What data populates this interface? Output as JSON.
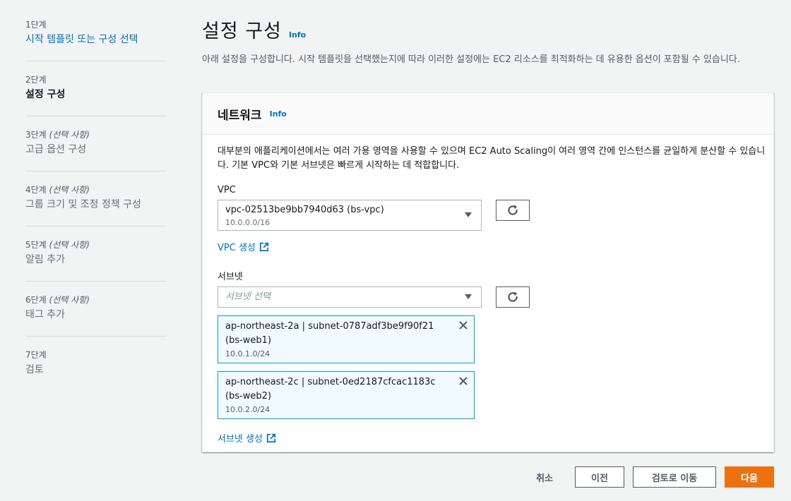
{
  "steps": [
    {
      "num": "1단계",
      "optional": "",
      "title": "시작 템플릿 또는 구성 선택",
      "state": "link"
    },
    {
      "num": "2단계",
      "optional": "",
      "title": "설정 구성",
      "state": "active"
    },
    {
      "num": "3단계",
      "optional": "(선택 사항)",
      "title": "고급 옵션 구성",
      "state": "disabled"
    },
    {
      "num": "4단계",
      "optional": "(선택 사항)",
      "title": "그룹 크기 및 조정 정책 구성",
      "state": "disabled"
    },
    {
      "num": "5단계",
      "optional": "(선택 사항)",
      "title": "알림 추가",
      "state": "disabled"
    },
    {
      "num": "6단계",
      "optional": "(선택 사항)",
      "title": "태그 추가",
      "state": "disabled"
    },
    {
      "num": "7단계",
      "optional": "",
      "title": "검토",
      "state": "disabled"
    }
  ],
  "header": {
    "title": "설정 구성",
    "info": "Info",
    "description": "아래 설정을 구성합니다. 시작 템플릿을 선택했는지에 따라 이러한 설정에는 EC2 리소스를 최적화하는 데 유용한 옵션이 포함될 수 있습니다."
  },
  "network": {
    "title": "네트워크",
    "info": "Info",
    "description": "대부분의 애플리케이션에서는 여러 가용 영역을 사용할 수 있으며 EC2 Auto Scaling이 여러 영역 간에 인스턴스를 균일하게 분산할 수 있습니다. 기본 VPC와 기본 서브넷은 빠르게 시작하는 데 적합합니다.",
    "vpc_label": "VPC",
    "vpc_value": "vpc-02513be9bb7940d63 (bs-vpc)",
    "vpc_cidr": "10.0.0.0/16",
    "vpc_create": "VPC 생성",
    "subnet_label": "서브넷",
    "subnet_placeholder": "서브넷 선택",
    "subnets": [
      {
        "name": "ap-northeast-2a | subnet-0787adf3be9f90f21 (bs-web1)",
        "cidr": "10.0.1.0/24"
      },
      {
        "name": "ap-northeast-2c | subnet-0ed2187cfcac1183c (bs-web2)",
        "cidr": "10.0.2.0/24"
      }
    ],
    "subnet_create": "서브넷 생성"
  },
  "footer": {
    "cancel": "취소",
    "previous": "이전",
    "skip_to_review": "검토로 이동",
    "next": "다음"
  },
  "colors": {
    "link": "#0073bb",
    "primary_button": "#ec7211",
    "token_border": "#00a1c9",
    "token_background": "#f1faff"
  },
  "icons": [
    "refresh-icon",
    "external-link-icon",
    "close-icon",
    "caret-down-icon"
  ]
}
